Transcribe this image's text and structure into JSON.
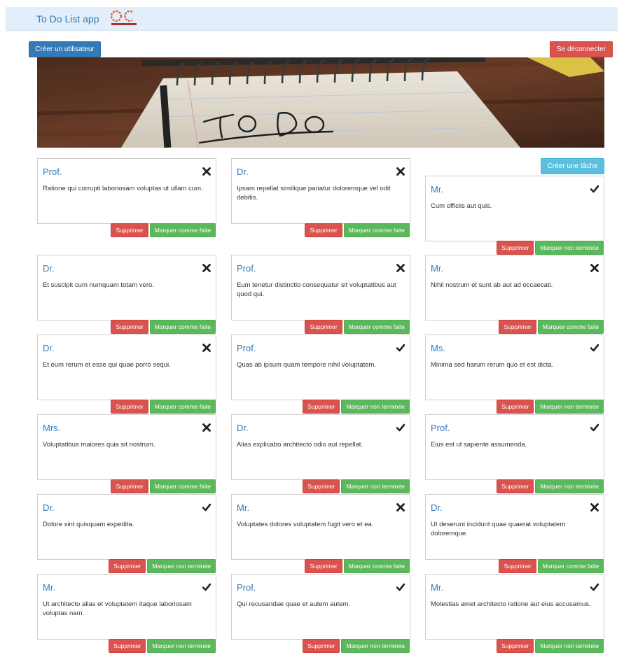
{
  "navbar": {
    "brand": "To Do List app",
    "logo_name": "openclassrooms-logo"
  },
  "toolbar": {
    "create_user_label": "Créer un utilisateur",
    "logout_label": "Se déconnecter",
    "create_task_label": "Créer une tâche"
  },
  "labels": {
    "delete": "Supprimer",
    "mark_done": "Marquer comme faite",
    "mark_undone": "Marquer non terminée"
  },
  "colors": {
    "primary": "#337ab7",
    "danger": "#d9534f",
    "success": "#5cb85c",
    "info": "#5bc0de",
    "navbar": "#e2effb"
  },
  "tasks": [
    {
      "title": "Prof.",
      "content": "Ratione qui corrupti laboriosam voluptas ut ullam cum.",
      "done": false
    },
    {
      "title": "Dr.",
      "content": "Ipsam repellat similique pariatur doloremque vel odit debitis.",
      "done": false
    },
    {
      "title": "Mr.",
      "content": "Cum officiis aut quis.",
      "done": true
    },
    {
      "title": "Dr.",
      "content": "Et suscipit cum numquam totam vero.",
      "done": false
    },
    {
      "title": "Prof.",
      "content": "Eum tenetur distinctio consequatur sit voluptatibus aut quod qui.",
      "done": false
    },
    {
      "title": "Mr.",
      "content": "Nihil nostrum et sunt ab aut ad occaecati.",
      "done": false
    },
    {
      "title": "Dr.",
      "content": "Et eum rerum et esse qui quae porro sequi.",
      "done": false
    },
    {
      "title": "Prof.",
      "content": "Quas ab ipsum quam tempore nihil voluptatem.",
      "done": true
    },
    {
      "title": "Ms.",
      "content": "Minima sed harum rerum quo et est dicta.",
      "done": true
    },
    {
      "title": "Mrs.",
      "content": "Voluptatibus maiores quia sit nostrum.",
      "done": false
    },
    {
      "title": "Dr.",
      "content": "Alias explicabo architecto odio aut repellat.",
      "done": true
    },
    {
      "title": "Prof.",
      "content": "Eius est ut sapiente assumenda.",
      "done": true
    },
    {
      "title": "Dr.",
      "content": "Dolore sint quisquam expedita.",
      "done": true
    },
    {
      "title": "Mr.",
      "content": "Voluptates dolores voluptatem fugit vero et ea.",
      "done": false
    },
    {
      "title": "Dr.",
      "content": "Ut deserunt incidunt quae quaerat voluptatem doloremque.",
      "done": false
    },
    {
      "title": "Mr.",
      "content": "Ut architecto alias et voluptatem itaque laboriosam voluptas nam.",
      "done": true
    },
    {
      "title": "Prof.",
      "content": "Qui recusandae quae et autem autem.",
      "done": true
    },
    {
      "title": "Mr.",
      "content": "Molestias amet architecto ratione aut eius accusamus.",
      "done": true
    }
  ]
}
